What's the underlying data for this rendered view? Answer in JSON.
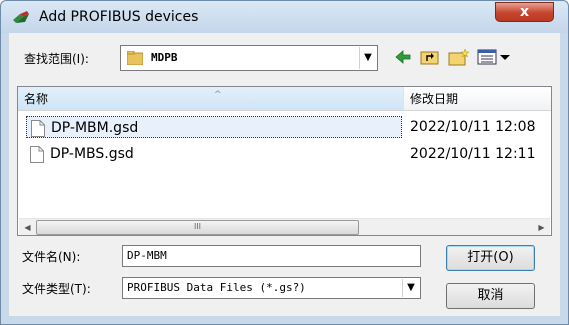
{
  "window": {
    "title": "Add PROFIBUS devices",
    "close_label": "x"
  },
  "lookin": {
    "label": "查找范围(I):",
    "value": "MDPB"
  },
  "toolbar": {
    "icons": [
      "back-arrow-icon",
      "up-folder-icon",
      "new-folder-icon",
      "view-menu-icon"
    ]
  },
  "list": {
    "columns": {
      "name": "名称",
      "modified": "修改日期"
    },
    "rows": [
      {
        "name": "DP-MBM.gsd",
        "modified": "2022/10/11 12:08",
        "selected": true
      },
      {
        "name": "DP-MBS.gsd",
        "modified": "2022/10/11 12:11",
        "selected": false
      }
    ],
    "scroll_thumb_grip": "III"
  },
  "filename": {
    "label": "文件名(N):",
    "value": "DP-MBM"
  },
  "filetype": {
    "label": "文件类型(T):",
    "value": "PROFIBUS Data Files (*.gs?)"
  },
  "buttons": {
    "open": "打开(O)",
    "cancel": "取消"
  }
}
